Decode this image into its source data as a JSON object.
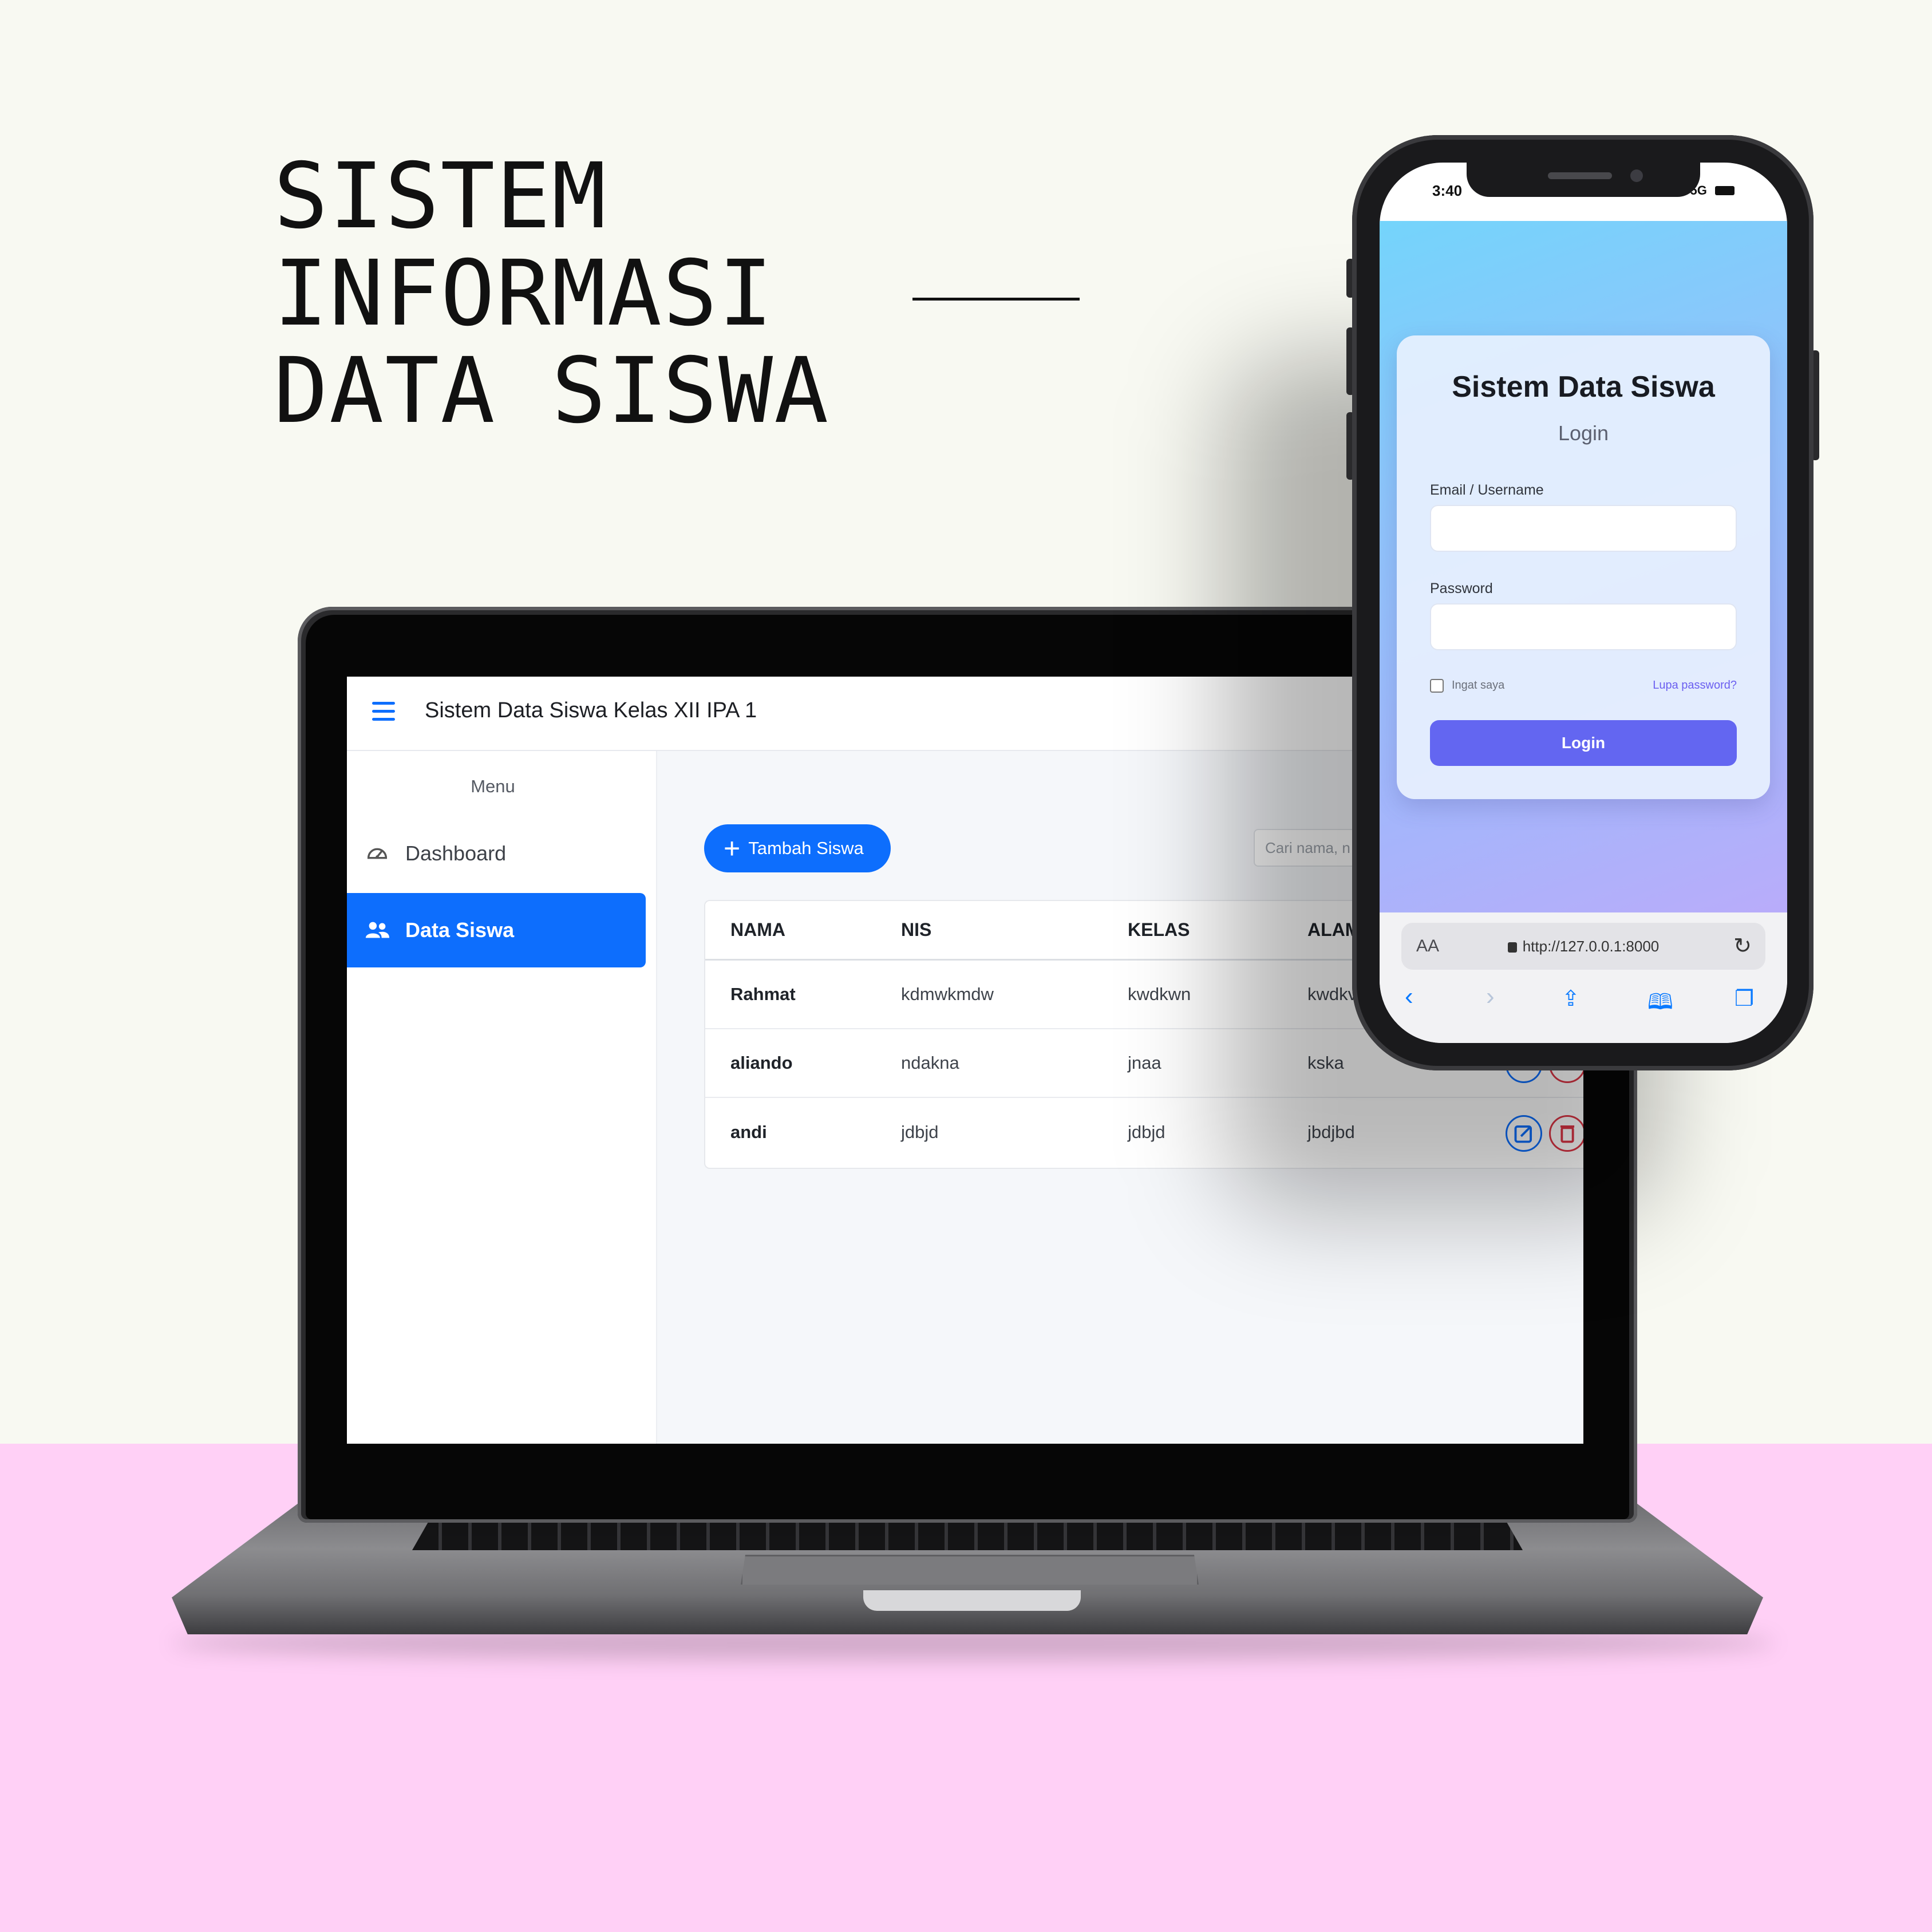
{
  "headline": {
    "line1": "SISTEM",
    "line2": "INFORMASI",
    "line3": "DATA SISWA"
  },
  "laptop_app": {
    "title": "Sistem Data Siswa Kelas XII IPA 1",
    "sidebar": {
      "menu_label": "Menu",
      "items": [
        {
          "label": "Dashboard",
          "icon": "speedometer-icon",
          "active": false
        },
        {
          "label": "Data Siswa",
          "icon": "users-icon",
          "active": true
        }
      ]
    },
    "add_button": "Tambah Siswa",
    "search_placeholder": "Cari nama, n",
    "table": {
      "headers": [
        "NAMA",
        "NIS",
        "KELAS",
        "ALAM"
      ],
      "rows": [
        {
          "nama": "Rahmat",
          "nis": "kdmwkmdw",
          "kelas": "kwdkwn",
          "alamat": "kwdkv"
        },
        {
          "nama": "aliando",
          "nis": "ndakna",
          "kelas": "jnaa",
          "alamat": "kska"
        },
        {
          "nama": "andi",
          "nis": "jdbjd",
          "kelas": "jdbjd",
          "alamat": "jbdjbd"
        }
      ]
    },
    "colors": {
      "primary": "#0d6efd",
      "danger": "#dc3545"
    }
  },
  "phone_app": {
    "status_time": "3:40",
    "status_network": "5G",
    "login": {
      "title": "Sistem Data Siswa",
      "subtitle": "Login",
      "email_label": "Email / Username",
      "password_label": "Password",
      "remember_label": "Ingat saya",
      "forgot_link": "Lupa password?",
      "button": "Login"
    },
    "browser": {
      "aa": "AA",
      "url": "http://127.0.0.1:8000",
      "nav_icons": [
        "back-icon",
        "forward-icon",
        "share-icon",
        "bookmarks-icon",
        "tabs-icon"
      ]
    },
    "colors": {
      "button": "#6366f1"
    }
  }
}
